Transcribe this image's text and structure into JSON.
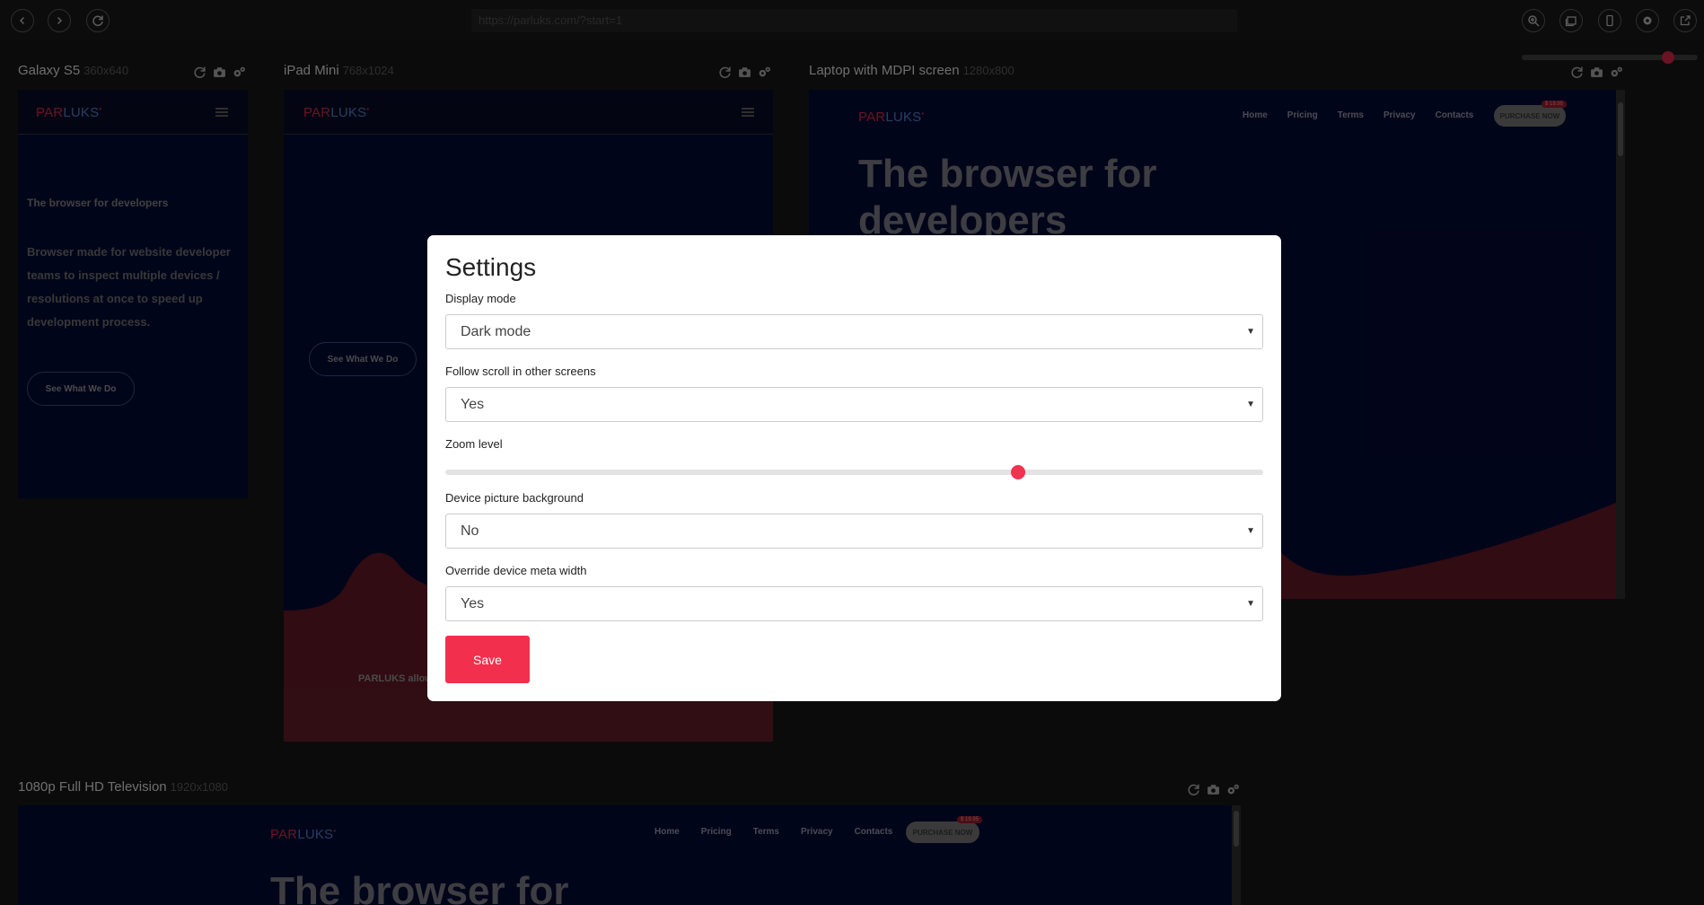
{
  "toolbar": {
    "url": "https://parluks.com/?start=1"
  },
  "devices": {
    "galaxy": {
      "name": "Galaxy S5",
      "res": "360x640"
    },
    "ipad": {
      "name": "iPad Mini",
      "res": "768x1024"
    },
    "laptop": {
      "name": "Laptop with MDPI screen",
      "res": "1280x800"
    },
    "tv": {
      "name": "1080p Full HD Television",
      "res": "1920x1080"
    }
  },
  "site": {
    "logo_par": "PAR",
    "logo_luks": "LUKS",
    "logo_mark": "•",
    "tagline": "The browser for developers",
    "description": "Browser made for website developer teams to inspect multiple devices / resolutions at once to speed up development process.",
    "cta": "See What We Do",
    "hero_line1": "The browser for",
    "hero_line2": "developers",
    "ipad_footer_text": "PARLUKS allow",
    "nav": [
      "Home",
      "Pricing",
      "Terms",
      "Privacy",
      "Contacts"
    ],
    "purchase": "PURCHASE NOW",
    "price": "$ 19.95"
  },
  "modal": {
    "title": "Settings",
    "display_mode": {
      "label": "Display mode",
      "value": "Dark mode"
    },
    "follow_scroll": {
      "label": "Follow scroll in other screens",
      "value": "Yes"
    },
    "zoom": {
      "label": "Zoom level",
      "value_fraction": 0.7
    },
    "device_bg": {
      "label": "Device picture background",
      "value": "No"
    },
    "override_meta": {
      "label": "Override device meta width",
      "value": "Yes"
    },
    "save_label": "Save"
  },
  "zoom_slider_fraction": 0.83,
  "colors": {
    "accent": "#f2304d",
    "site_bg": "#030a2e",
    "site_wave": "#5a1722"
  }
}
